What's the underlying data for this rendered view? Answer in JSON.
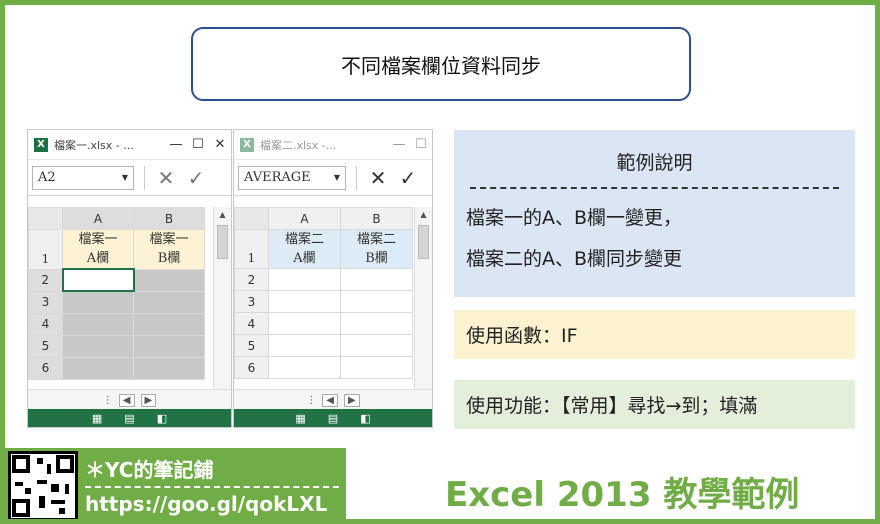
{
  "title": "不同檔案欄位資料同步",
  "window1": {
    "title": "檔案一.xlsx - ...",
    "namebox": "A2",
    "columns": [
      "A",
      "B"
    ],
    "header_a": [
      "檔案一",
      "A欄"
    ],
    "header_b": [
      "檔案一",
      "B欄"
    ],
    "rows": [
      "1",
      "2",
      "3",
      "4",
      "5",
      "6"
    ]
  },
  "window2": {
    "title": "檔案二.xlsx -...",
    "namebox": "AVERAGE",
    "columns": [
      "A",
      "B"
    ],
    "header_a": [
      "檔案二",
      "A欄"
    ],
    "header_b": [
      "檔案二",
      "B欄"
    ],
    "rows": [
      "1",
      "2",
      "3",
      "4",
      "5",
      "6"
    ]
  },
  "description": {
    "heading": "範例說明",
    "line1": "檔案一的A、B欄一變更，",
    "line2": "檔案二的A、B欄同步變更"
  },
  "function_text": "使用函數：IF",
  "feature_text": "使用功能：【常用】尋找→到；填滿",
  "footer": {
    "name": "＊YC的筆記鋪",
    "url": "https://goo.gl/qokLXL"
  },
  "brand": "Excel 2013 教學範例",
  "colors": {
    "accent": "#70ad47",
    "excel_green": "#217346",
    "title_border": "#2e4e8f"
  }
}
